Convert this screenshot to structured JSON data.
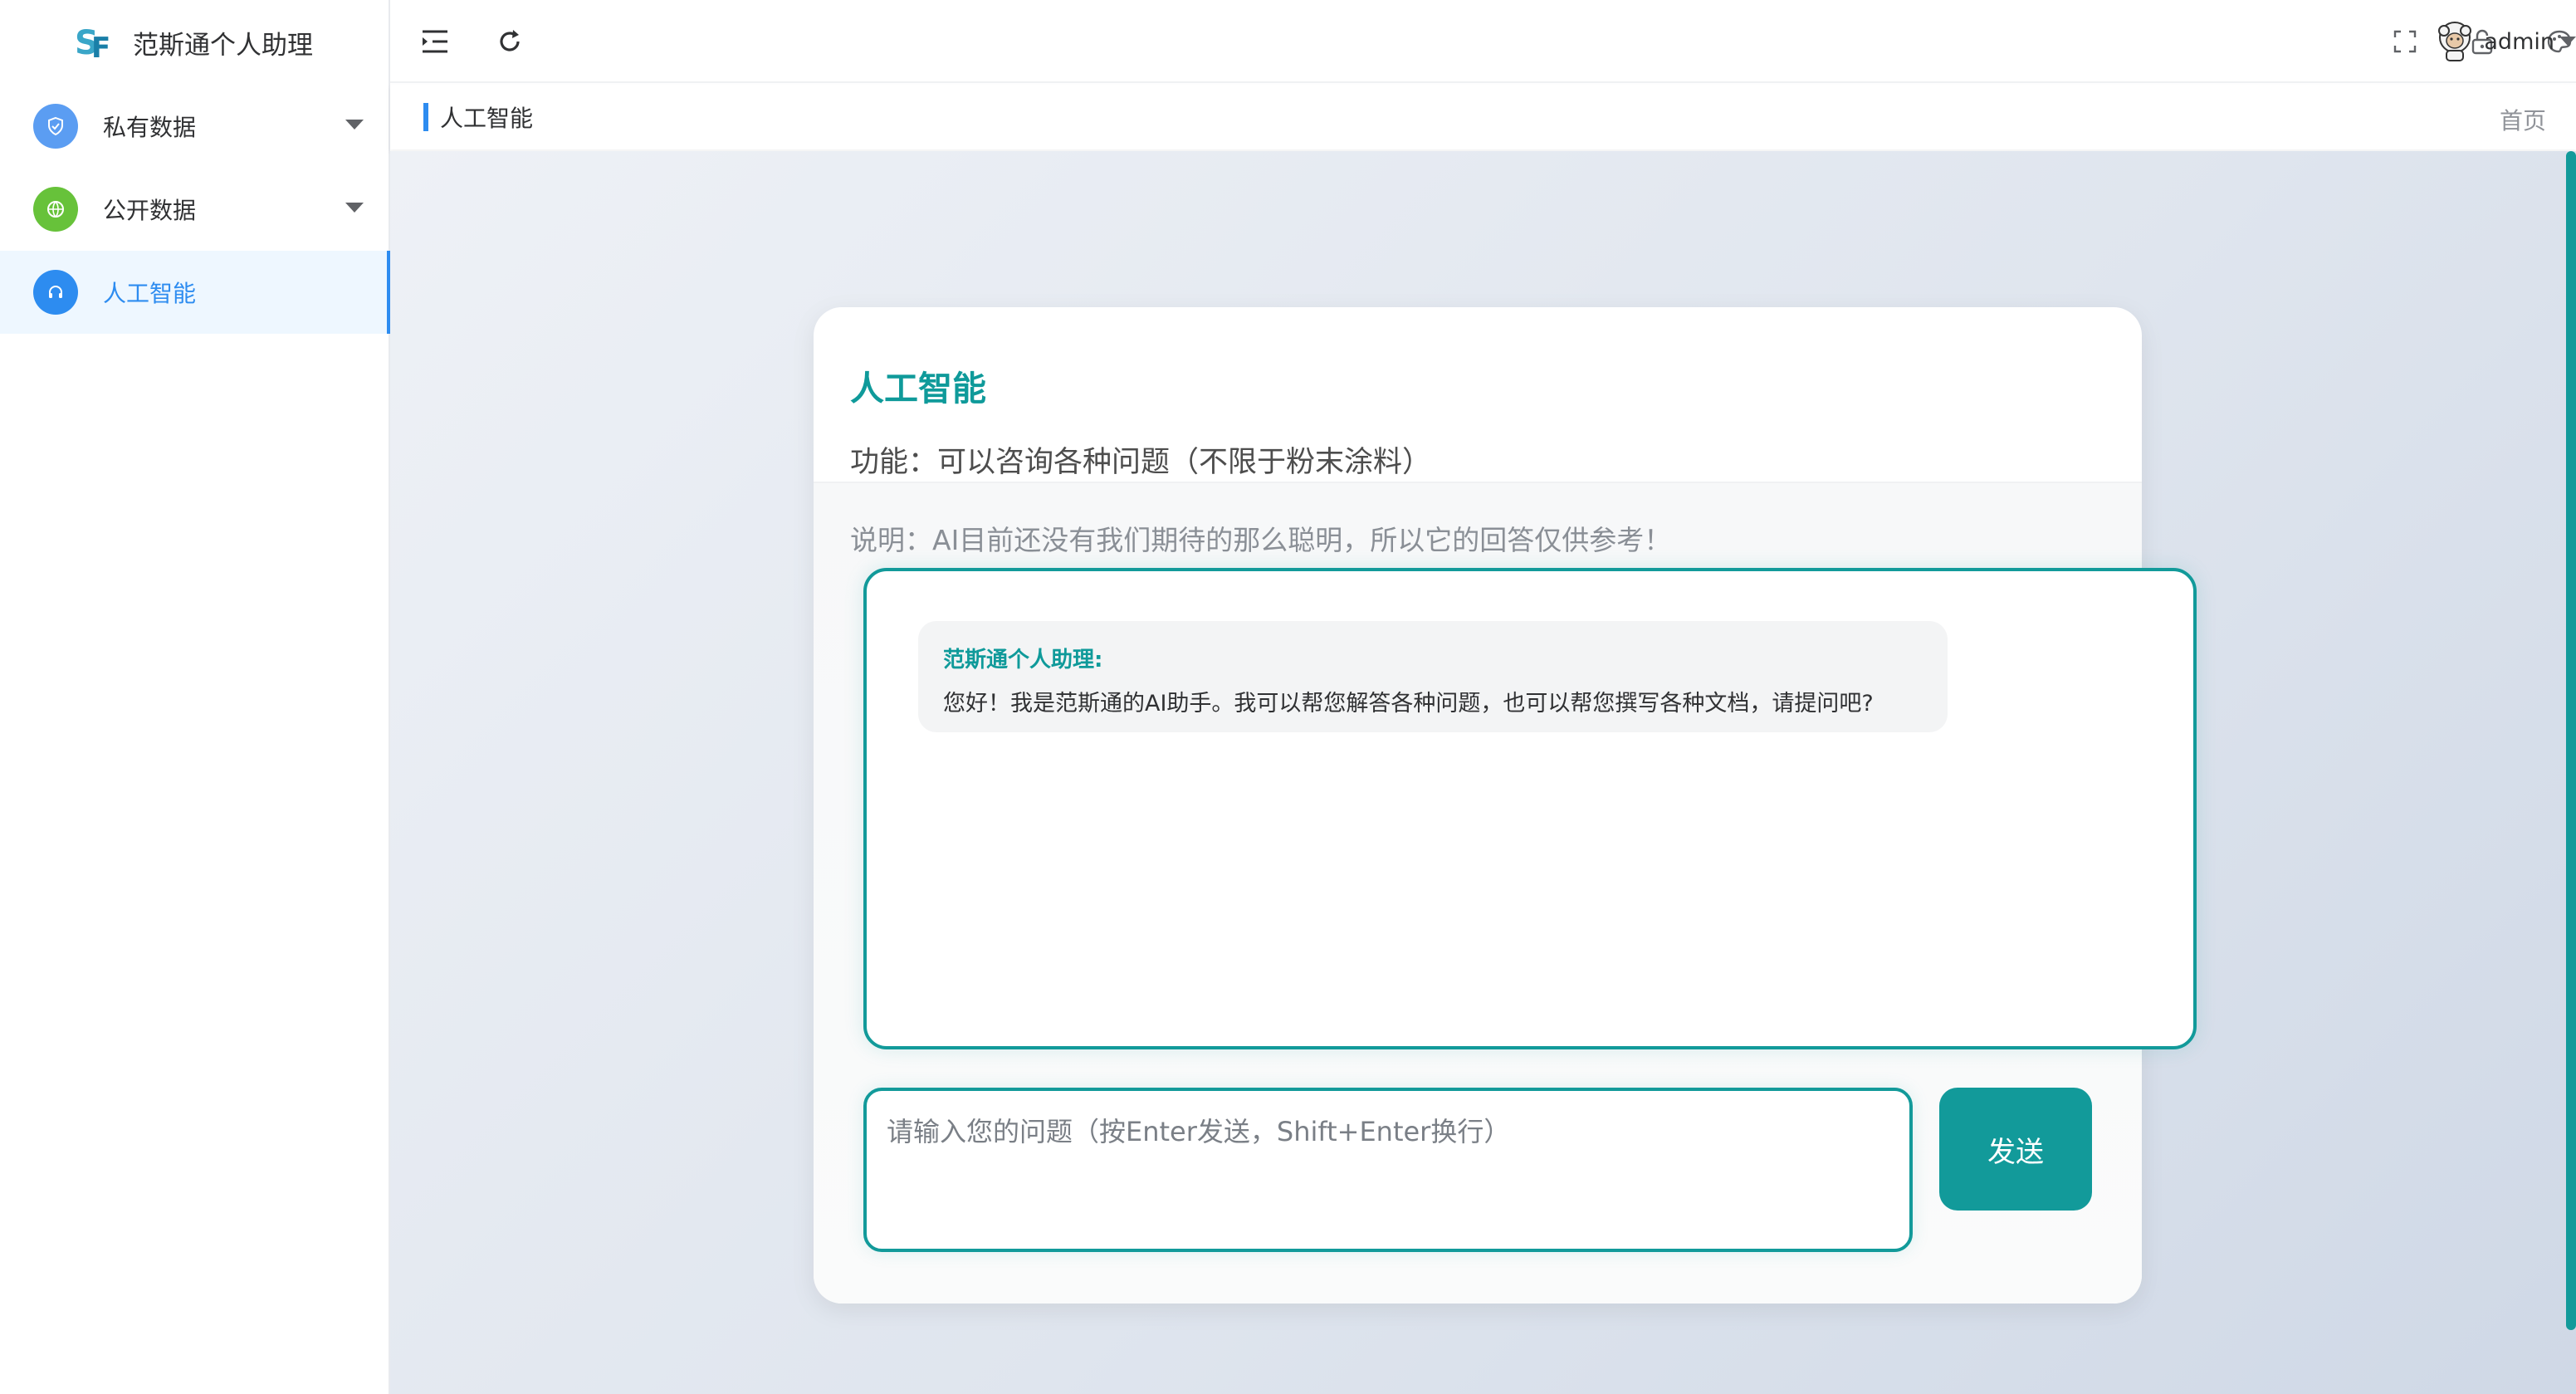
{
  "app": {
    "title": "范斯通个人助理",
    "logo_icon": "sf-logo-icon"
  },
  "sidebar": {
    "items": [
      {
        "label": "私有数据",
        "icon": "shield-icon",
        "icon_color": "#5b9df2",
        "has_submenu": true,
        "active": false
      },
      {
        "label": "公开数据",
        "icon": "globe-icon",
        "icon_color": "#67c23a",
        "has_submenu": true,
        "active": false
      },
      {
        "label": "人工智能",
        "icon": "headset-icon",
        "icon_color": "#2d8cf0",
        "has_submenu": false,
        "active": true
      }
    ]
  },
  "header": {
    "collapse_icon": "menu-fold-icon",
    "refresh_icon": "refresh-icon",
    "fullscreen_icon": "fullscreen-icon",
    "lock_icon": "lock-icon",
    "theme_icon": "palette-icon",
    "user": {
      "name": "admin",
      "avatar_icon": "sheep-avatar-icon"
    }
  },
  "tags": {
    "current": "人工智能",
    "home": "首页"
  },
  "card": {
    "title": "人工智能",
    "function": "功能：可以咨询各种问题（不限于粉末涂料）",
    "note": "说明：AI目前还没有我们期待的那么聪明，所以它的回答仅供参考！"
  },
  "chat": {
    "messages": [
      {
        "sender": "范斯通个人助理:",
        "text": "您好！我是范斯通的AI助手。我可以帮您解答各种问题，也可以帮您撰写各种文档，请提问吧?"
      }
    ],
    "input": {
      "placeholder": "请输入您的问题（按Enter发送，Shift+Enter换行）",
      "value": ""
    },
    "send_label": "发送"
  },
  "colors": {
    "accent": "#129a9a",
    "active_blue": "#2d8cf0"
  }
}
